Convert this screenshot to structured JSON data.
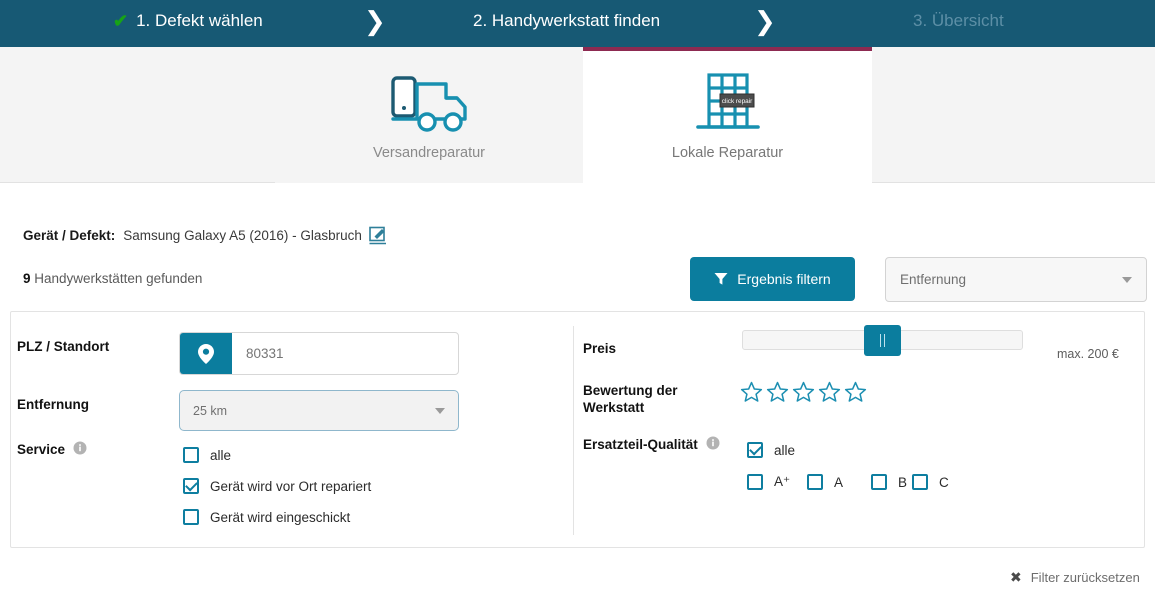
{
  "steps": {
    "step1": {
      "label": "1. Defekt wählen",
      "icon": "check-icon",
      "state": "completed"
    },
    "step2": {
      "label": "2. Handywerkstatt finden",
      "state": "active"
    },
    "step3": {
      "label": "3. Übersicht",
      "state": "upcoming"
    },
    "separator_icon": "chevron-right-icon"
  },
  "tabs": [
    {
      "id": "versandreparatur",
      "label": "Versandreparatur",
      "icon": "truck-shipping-icon",
      "active": false
    },
    {
      "id": "lokale-reparatur",
      "label": "Lokale Reparatur",
      "icon": "repair-shop-building-icon",
      "sign_text": "click repair",
      "active": true
    }
  ],
  "device": {
    "label": "Gerät / Defekt:",
    "value": "Samsung Galaxy A5 (2016) - Glasbruch",
    "edit_icon": "edit-pencil-icon"
  },
  "results": {
    "count": "9",
    "text": "Handywerkstätten gefunden"
  },
  "toolbar": {
    "filter_button_label": "Ergebnis filtern",
    "filter_icon": "funnel-icon",
    "sort_selected": "Entfernung",
    "sort_caret_icon": "chevron-down-icon"
  },
  "filters": {
    "plz": {
      "label": "PLZ / Standort",
      "value": "80331",
      "placeholder": "80331",
      "pin_icon": "location-pin-icon"
    },
    "entfernung": {
      "label": "Entfernung",
      "selected": "25 km",
      "caret_icon": "chevron-down-icon"
    },
    "service": {
      "label": "Service",
      "info_icon": "info-circle-icon",
      "options": [
        {
          "label": "alle",
          "checked": false
        },
        {
          "label": "Gerät wird vor Ort repariert",
          "checked": true
        },
        {
          "label": "Gerät wird eingeschickt",
          "checked": false
        }
      ]
    },
    "preis": {
      "label": "Preis",
      "max_label": "max. 200 €",
      "handle_icon": "slider-handle-icon"
    },
    "bewertung": {
      "label_line1": "Bewertung der",
      "label_line2": "Werkstatt",
      "stars_total": 5,
      "stars_selected": 0,
      "star_icon": "star-outline-icon"
    },
    "ersatzteil": {
      "label": "Ersatzteil-Qualität",
      "info_icon": "info-circle-icon",
      "all_option": {
        "label": "alle",
        "checked": true
      },
      "grades": [
        {
          "label": "A⁺",
          "checked": false
        },
        {
          "label": "A",
          "checked": false
        },
        {
          "label": "B",
          "checked": false
        },
        {
          "label": "C",
          "checked": false
        }
      ]
    }
  },
  "reset": {
    "label": "Filter zurücksetzen",
    "icon": "close-x-icon"
  },
  "colors": {
    "header_bg": "#175974",
    "accent_teal": "#0b7d9e",
    "active_tab_border": "#8d2a51",
    "check_green": "#17a317",
    "muted_step": "#5d8fa6"
  }
}
